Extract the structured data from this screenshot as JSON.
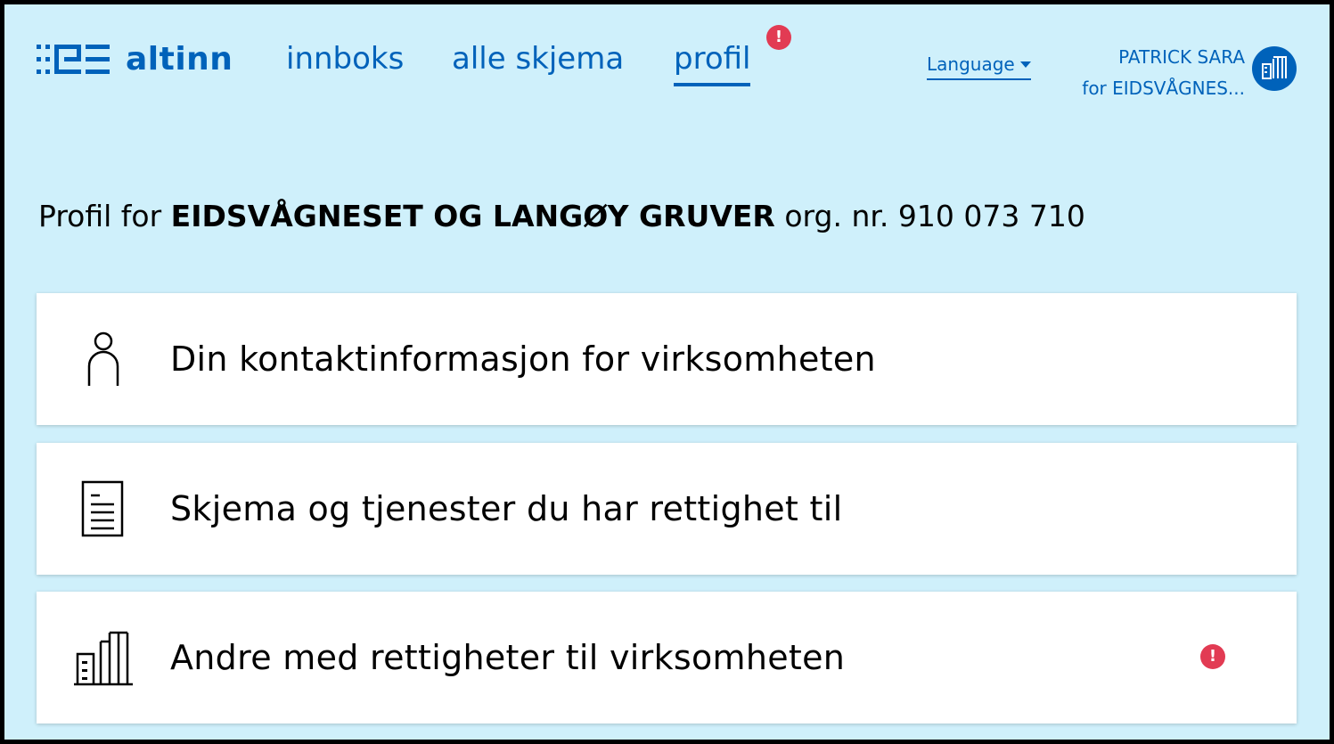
{
  "header": {
    "logo_text": "altinn",
    "nav": [
      {
        "label": "innboks",
        "active": false
      },
      {
        "label": "alle skjema",
        "active": false
      },
      {
        "label": "profil",
        "active": true
      }
    ],
    "nav_alert": "!",
    "language_label": "Language",
    "user_name": "PATRICK SARA",
    "user_org": "for EIDSVÅGNES..."
  },
  "main": {
    "heading_prefix": "Profil for",
    "org_name": "EIDSVÅGNESET OG LANGØY GRUVER",
    "org_number_label": "org. nr. 910 073 710",
    "cards": [
      {
        "label": "Din kontaktinformasjon for virksomheten",
        "icon": "person-icon",
        "alert": false
      },
      {
        "label": "Skjema og tjenester du har rettighet til",
        "icon": "document-icon",
        "alert": false
      },
      {
        "label": "Andre med rettigheter til virksomheten",
        "icon": "building-icon",
        "alert": true,
        "alert_text": "!"
      }
    ]
  },
  "colors": {
    "background": "#cff0fb",
    "primary": "#0062ba",
    "alert": "#e23b53",
    "card": "#ffffff"
  }
}
